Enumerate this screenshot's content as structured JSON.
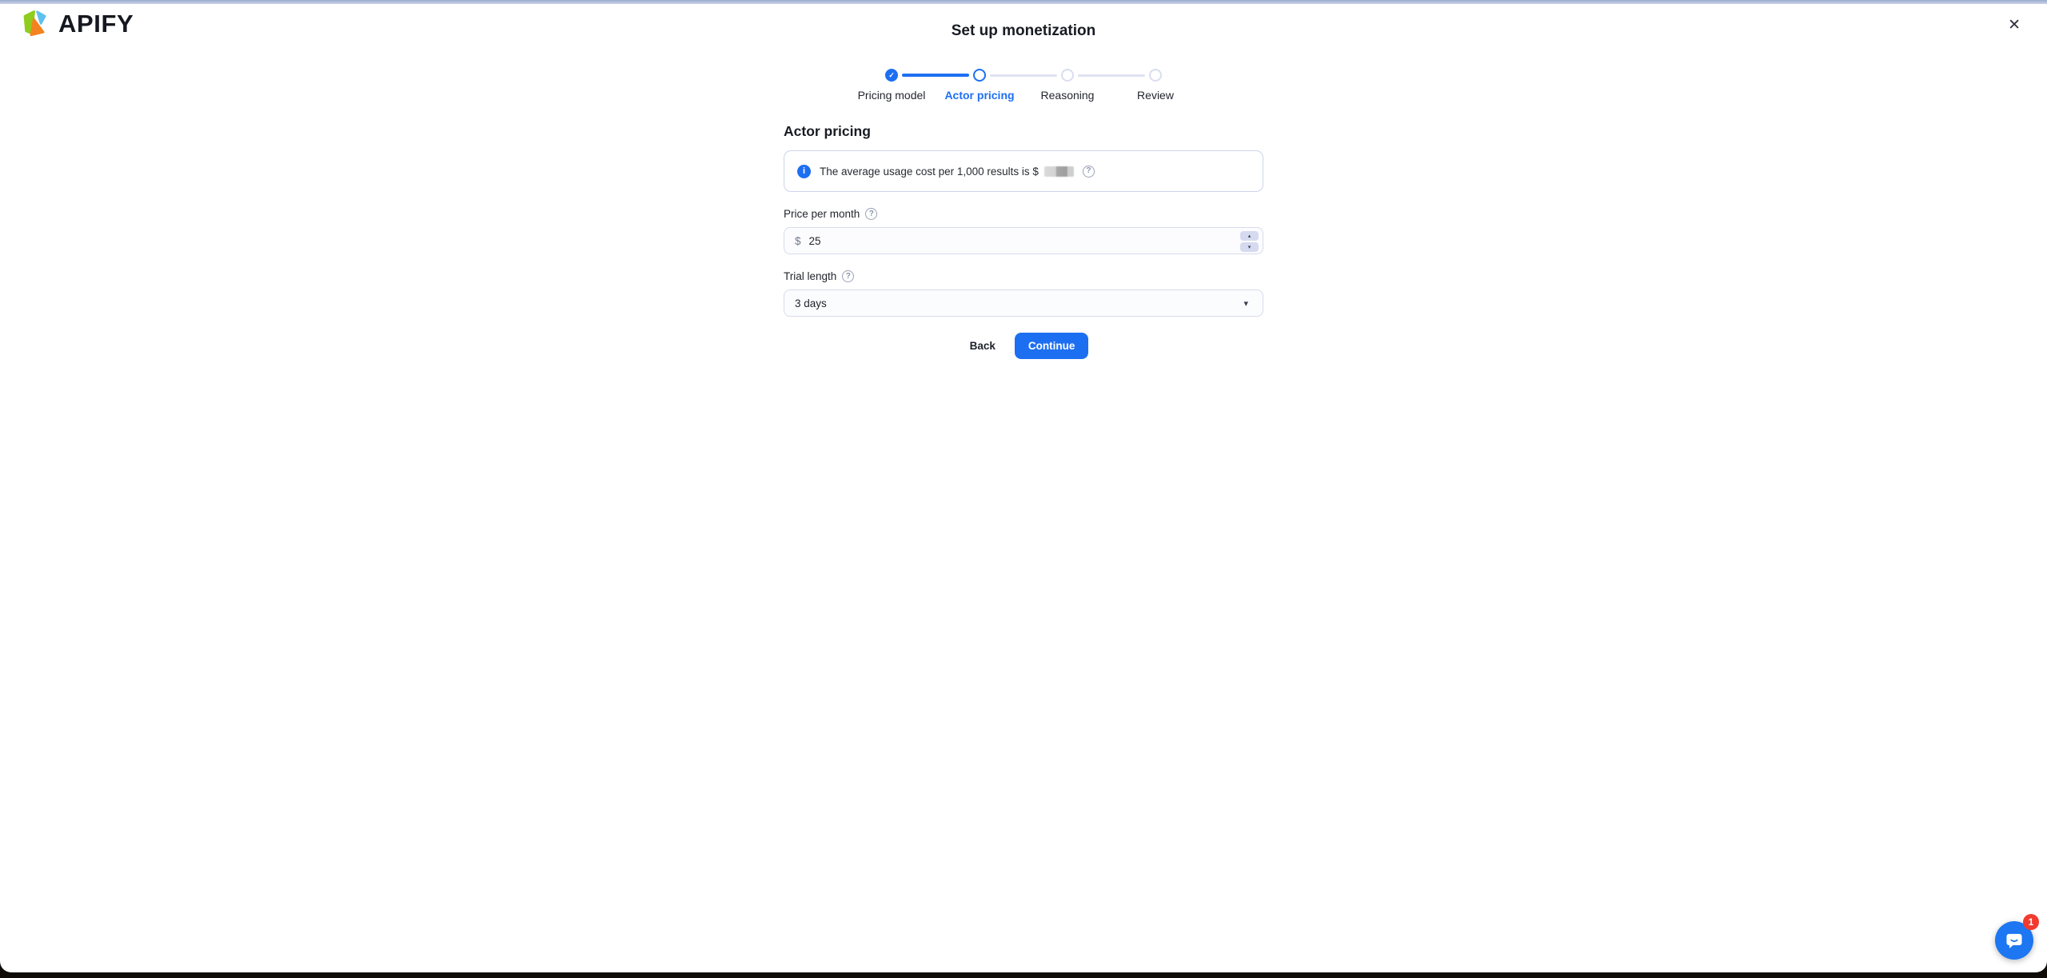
{
  "header": {
    "brand": "APIFY"
  },
  "icons": {
    "close": "✕",
    "check": "✓",
    "info": "i",
    "help": "?",
    "caret_down": "▾",
    "step_up": "▴",
    "step_down": "▾"
  },
  "modal": {
    "title": "Set up monetization",
    "steps": [
      {
        "label": "Pricing model",
        "state": "completed"
      },
      {
        "label": "Actor pricing",
        "state": "active"
      },
      {
        "label": "Reasoning",
        "state": "upcoming"
      },
      {
        "label": "Review",
        "state": "upcoming"
      }
    ],
    "section_title": "Actor pricing",
    "info_banner": {
      "text": "The average usage cost per 1,000 results is $",
      "value_masked": true
    },
    "price_field": {
      "label": "Price per month",
      "currency": "$",
      "value": "25"
    },
    "trial_field": {
      "label": "Trial length",
      "value": "3 days"
    },
    "actions": {
      "back": "Back",
      "continue": "Continue"
    }
  },
  "chat": {
    "badge": "1"
  },
  "colors": {
    "accent": "#1d6ff2",
    "chat": "#1d76f2",
    "badge": "#f23a2e",
    "brand_green": "#8fcc1f",
    "brand_orange": "#f4831f",
    "brand_blue": "#5ec0ef"
  }
}
